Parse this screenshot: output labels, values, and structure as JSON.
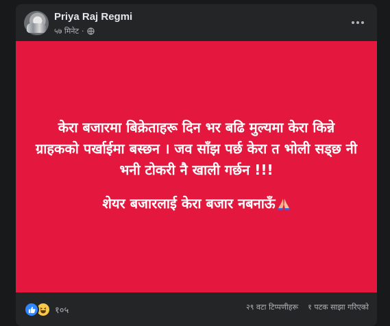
{
  "post": {
    "author": "Priya Raj Regmi",
    "time": "५७ मिनेट",
    "separator": "·",
    "privacy_icon": "globe-icon",
    "menu_icon": "more-options-icon"
  },
  "poster": {
    "background": "#e4173e",
    "line1": "केरा बजारमा बिक्रेताहरू दिन भर बढि मुल्यमा केरा किन्ने ग्राहकको पर्खाईमा बस्छन । जव साँझ पर्छ केरा त भोली सड्छ नी भनी टोकरी नै खाली गर्छन !!!",
    "line2": "शेयर बजारलाई केरा बजार नबनाऊँ",
    "emoji": "folded-hands-icon"
  },
  "footer": {
    "reaction_icons": [
      "like-icon",
      "haha-icon"
    ],
    "reaction_count": "१०५",
    "comments": "२९ वटा टिप्पणीहरू",
    "shares": "१ पटक साझा गरिएको"
  }
}
